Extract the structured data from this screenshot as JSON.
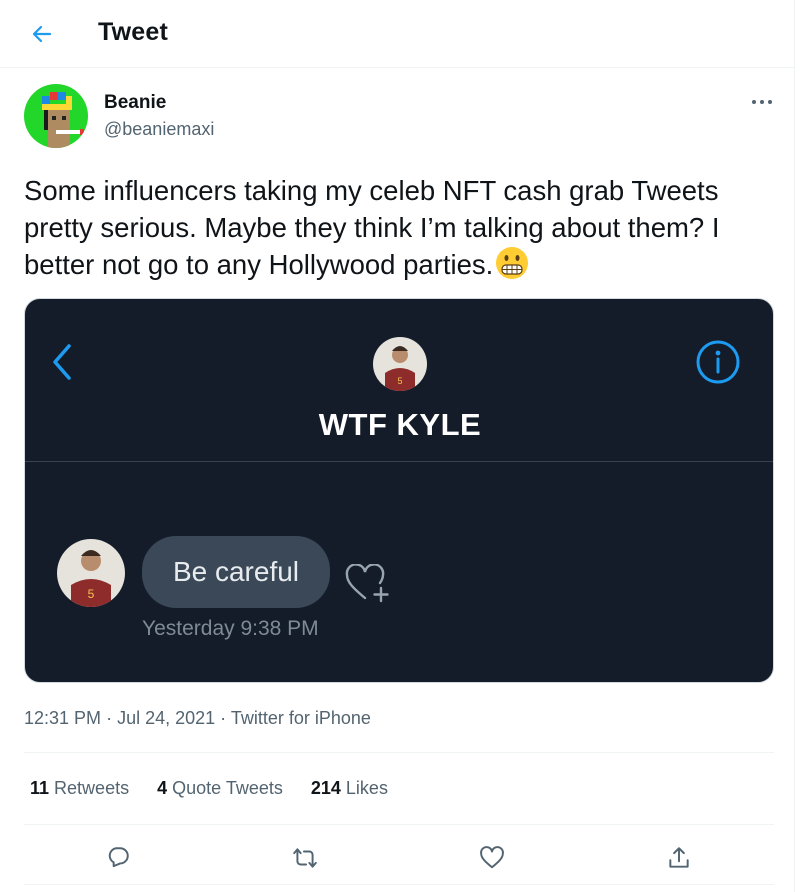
{
  "header": {
    "title": "Tweet"
  },
  "author": {
    "name": "Beanie",
    "handle": "@beaniemaxi"
  },
  "tweet": {
    "text": "Some influencers taking my celeb NFT cash grab Tweets pretty serious. Maybe they think I’m talking about them? I better not go to any Hollywood parties."
  },
  "media": {
    "contact_name": "WTF KYLE",
    "message": "Be careful",
    "message_time": "Yesterday 9:38 PM"
  },
  "meta": {
    "time": "12:31 PM",
    "separator": "·",
    "date": "Jul 24, 2021",
    "source": "Twitter for iPhone"
  },
  "stats": {
    "retweets_count": "11",
    "retweets_label": "Retweets",
    "quotes_count": "4",
    "quotes_label": "Quote Tweets",
    "likes_count": "214",
    "likes_label": "Likes"
  },
  "colors": {
    "accent": "#1d9bf0",
    "text": "#0f1419",
    "secondary": "#536471",
    "media_bg": "#141c2a",
    "bubble": "#3a4858"
  },
  "icons": [
    "back-arrow-icon",
    "more-icon",
    "emoji-grimacing",
    "chevron-left-icon",
    "info-icon",
    "heart-plus-icon",
    "reply-icon",
    "retweet-icon",
    "like-icon",
    "share-icon"
  ]
}
